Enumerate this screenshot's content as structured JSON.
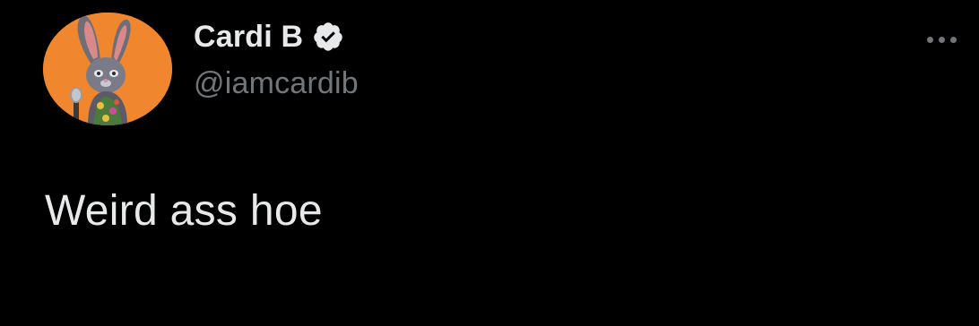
{
  "tweet": {
    "author": {
      "display_name": "Cardi B",
      "handle": "@iamcardib",
      "verified": true,
      "avatar_icon": "bunny-character-avatar",
      "avatar_bg": "#f0872e"
    },
    "text": "Weird ass hoe",
    "more_icon": "more-horizontal-icon"
  },
  "colors": {
    "background": "#000000",
    "primary_text": "#e7e9ea",
    "secondary_text": "#71767b",
    "verified_badge": "#e7e9ea"
  }
}
